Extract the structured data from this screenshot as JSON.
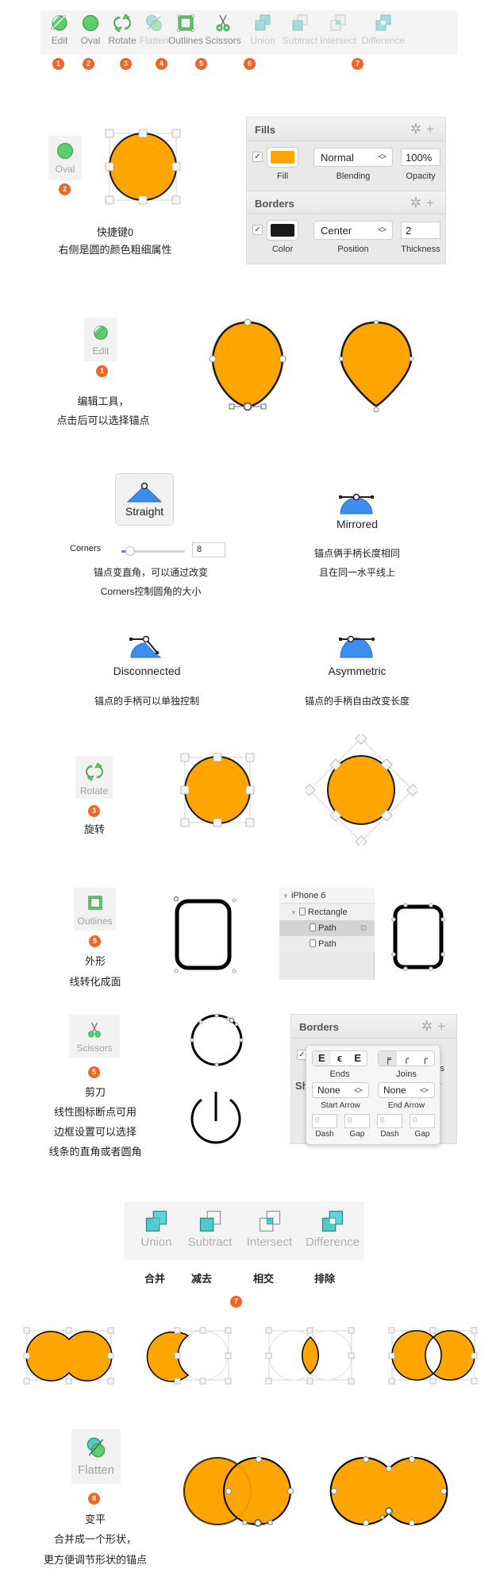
{
  "toolbar": {
    "items": [
      {
        "label": "Edit",
        "icon": "edit-icon",
        "dim": false
      },
      {
        "label": "Oval",
        "icon": "oval-icon",
        "dim": false
      },
      {
        "label": "Rotate",
        "icon": "rotate-icon",
        "dim": false
      },
      {
        "label": "Flatten",
        "icon": "flatten-icon",
        "dim": true
      },
      {
        "label": "Outlines",
        "icon": "outlines-icon",
        "dim": false
      },
      {
        "label": "Scissors",
        "icon": "scissors-icon",
        "dim": false
      },
      {
        "label": "Union",
        "icon": "union-icon",
        "dim": true
      },
      {
        "label": "Subtract",
        "icon": "subtract-icon",
        "dim": true
      },
      {
        "label": "Intersect",
        "icon": "intersect-icon",
        "dim": true
      },
      {
        "label": "Difference",
        "icon": "difference-icon",
        "dim": true
      }
    ],
    "badges": [
      "1",
      "2",
      "3",
      "4",
      "5",
      "6",
      "7"
    ]
  },
  "colors": {
    "accent_orange": "#f26522",
    "shape_fill": "#ffa500",
    "tool_green": "#5ccf6a",
    "bool_teal": "#4fc9c9",
    "anchor_blue": "#3d8ef0"
  },
  "oval_section": {
    "tool_label": "Oval",
    "badge": "2",
    "caption_line1": "快捷键0",
    "caption_line2": "右侧是圆的颜色粗细属性",
    "fills": {
      "title": "Fills",
      "checked": "✓",
      "fill_color": "#ffa500",
      "blending": "Normal",
      "opacity": "100%",
      "labels": [
        "Fill",
        "Blending",
        "Opacity"
      ]
    },
    "borders": {
      "title": "Borders",
      "checked": "✓",
      "color": "#1a1a1a",
      "position": "Center",
      "thickness": "2",
      "labels": [
        "Color",
        "Position",
        "Thickness"
      ]
    }
  },
  "edit_section": {
    "tool_label": "Edit",
    "badge": "1",
    "caption_line1": "编辑工具，",
    "caption_line2": "点击后可以选择锚点"
  },
  "anchor_section": {
    "straight": {
      "label": "Straight",
      "corners_label": "Corners",
      "corners_value": "8",
      "corners_fraction": 0.08,
      "desc1": "锚点变直角，可以通过改变",
      "desc2": "Corners控制圆角的大小"
    },
    "mirrored": {
      "label": "Mirrored",
      "desc1": "锚点俩手柄长度相同",
      "desc2": "且在同一水平线上"
    },
    "disconnected": {
      "label": "Disconnected",
      "desc": "锚点的手柄可以单独控制"
    },
    "asymmetric": {
      "label": "Asymmetric",
      "desc": "锚点的手柄自由改变长度"
    }
  },
  "rotate_section": {
    "tool_label": "Rotate",
    "badge": "3",
    "caption": "旋转"
  },
  "outlines_section": {
    "tool_label": "Outlines",
    "badge": "5",
    "caption_line1": "外形",
    "caption_line2": "线转化成面",
    "layers": [
      {
        "name": "iPhone 6",
        "level": 0,
        "expanded": true
      },
      {
        "name": "Rectangle",
        "level": 1,
        "expanded": true
      },
      {
        "name": "Path",
        "level": 2,
        "selected": true
      },
      {
        "name": "Path",
        "level": 2,
        "selected": false
      }
    ]
  },
  "scissors_section": {
    "tool_label": "Scissors",
    "badge": "5",
    "caption_line1": "剪刀",
    "caption_line2": "线性图标断点可用",
    "caption_line3": "边框设置可以选择",
    "caption_line4": "线条的直角或者圆角",
    "borders_popup": {
      "title": "Borders",
      "shadow_partial": "Sh",
      "thickness_partial": "ss",
      "ends_label": "Ends",
      "joins_label": "Joins",
      "start_arrow": "None",
      "end_arrow": "None",
      "start_arrow_label": "Start Arrow",
      "end_arrow_label": "End Arrow",
      "dash_fields": [
        {
          "placeholder": "0",
          "label": "Dash"
        },
        {
          "placeholder": "0",
          "label": "Gap"
        },
        {
          "placeholder": "0",
          "label": "Dash"
        },
        {
          "placeholder": "0",
          "label": "Gap"
        }
      ]
    }
  },
  "boolean_section": {
    "items": [
      {
        "label": "Union",
        "cn": "合并"
      },
      {
        "label": "Subtract",
        "cn": "减去"
      },
      {
        "label": "Intersect",
        "cn": "相交"
      },
      {
        "label": "Difference",
        "cn": "排除"
      }
    ],
    "badge": "7"
  },
  "flatten_section": {
    "tool_label": "Flatten",
    "badge": "8",
    "caption_line1": "变平",
    "caption_line2": "合并成一个形状，",
    "caption_line3": "更方便调节形状的锚点"
  }
}
